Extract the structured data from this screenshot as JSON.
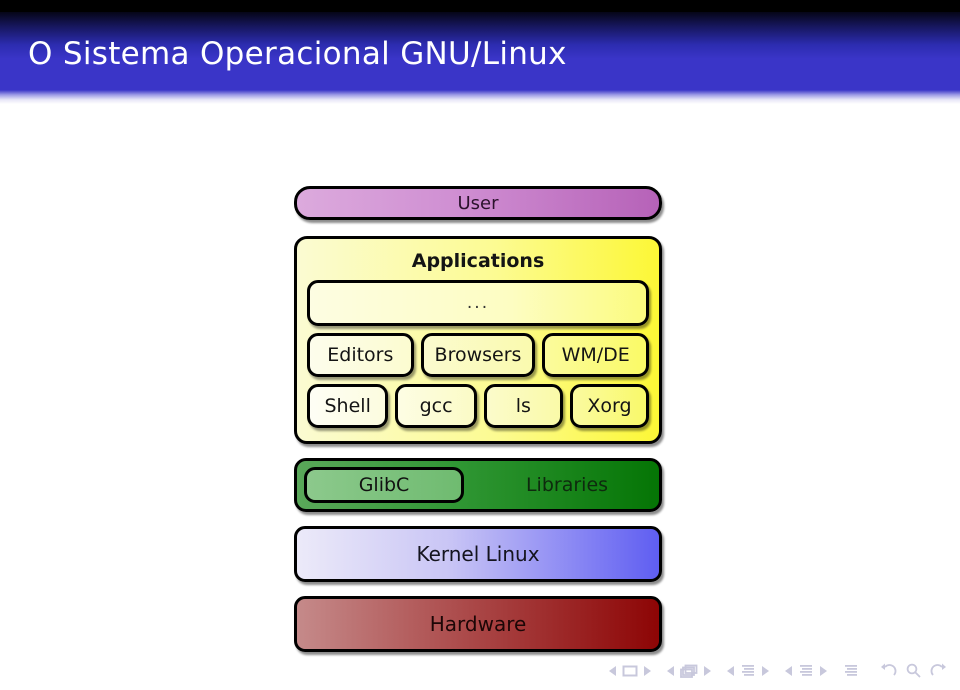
{
  "slide": {
    "title": "O Sistema Operacional GNU/Linux",
    "accent_color": "#3a35c8",
    "background_color": "#ffffff",
    "top_strip_color": "#000000"
  },
  "diagram": {
    "type": "layer-stack",
    "layers": [
      {
        "id": "user",
        "label": "User",
        "color_from": "#dcaadd",
        "color_to": "#b662b8"
      },
      {
        "id": "applications",
        "label": "Applications",
        "color_from": "#fbfbd2",
        "color_to": "#fcf736"
      },
      {
        "id": "libraries",
        "label": "Libraries",
        "color_from": "#5aa85a",
        "color_to": "#057505"
      },
      {
        "id": "kernel",
        "label": "Kernel Linux",
        "color_from": "#eceaf9",
        "color_to": "#5f5ef2"
      },
      {
        "id": "hardware",
        "label": "Hardware",
        "color_from": "#c58a8a",
        "color_to": "#8d0505"
      }
    ],
    "applications": {
      "title": "Applications",
      "placeholder": "...",
      "row1": [
        "Editors",
        "Browsers",
        "WM/DE"
      ],
      "row2": [
        "Shell",
        "gcc",
        "ls",
        "Xorg"
      ]
    },
    "libraries": {
      "inner_label": "GlibC",
      "outer_label": "Libraries"
    },
    "kernel": {
      "label": "Kernel Linux"
    },
    "hardware": {
      "label": "Hardware"
    },
    "user": {
      "label": "User"
    }
  },
  "navigation": {
    "color": "#c8c8dc",
    "groups": [
      {
        "name": "slide",
        "icon": "slide-icon",
        "prev": "◂",
        "next": "▸"
      },
      {
        "name": "frame",
        "icon": "frame-icon",
        "prev": "◂",
        "next": "▸"
      },
      {
        "name": "subsection",
        "icon": "subsection-icon",
        "prev": "◂",
        "next": "▸"
      },
      {
        "name": "section",
        "icon": "section-icon",
        "prev": "◂",
        "next": "▸"
      }
    ],
    "doc_icon": "document-icon",
    "back_icon": "back-arrow-icon",
    "search_icon": "search-icon",
    "forward_icon": "forward-arrow-icon"
  }
}
